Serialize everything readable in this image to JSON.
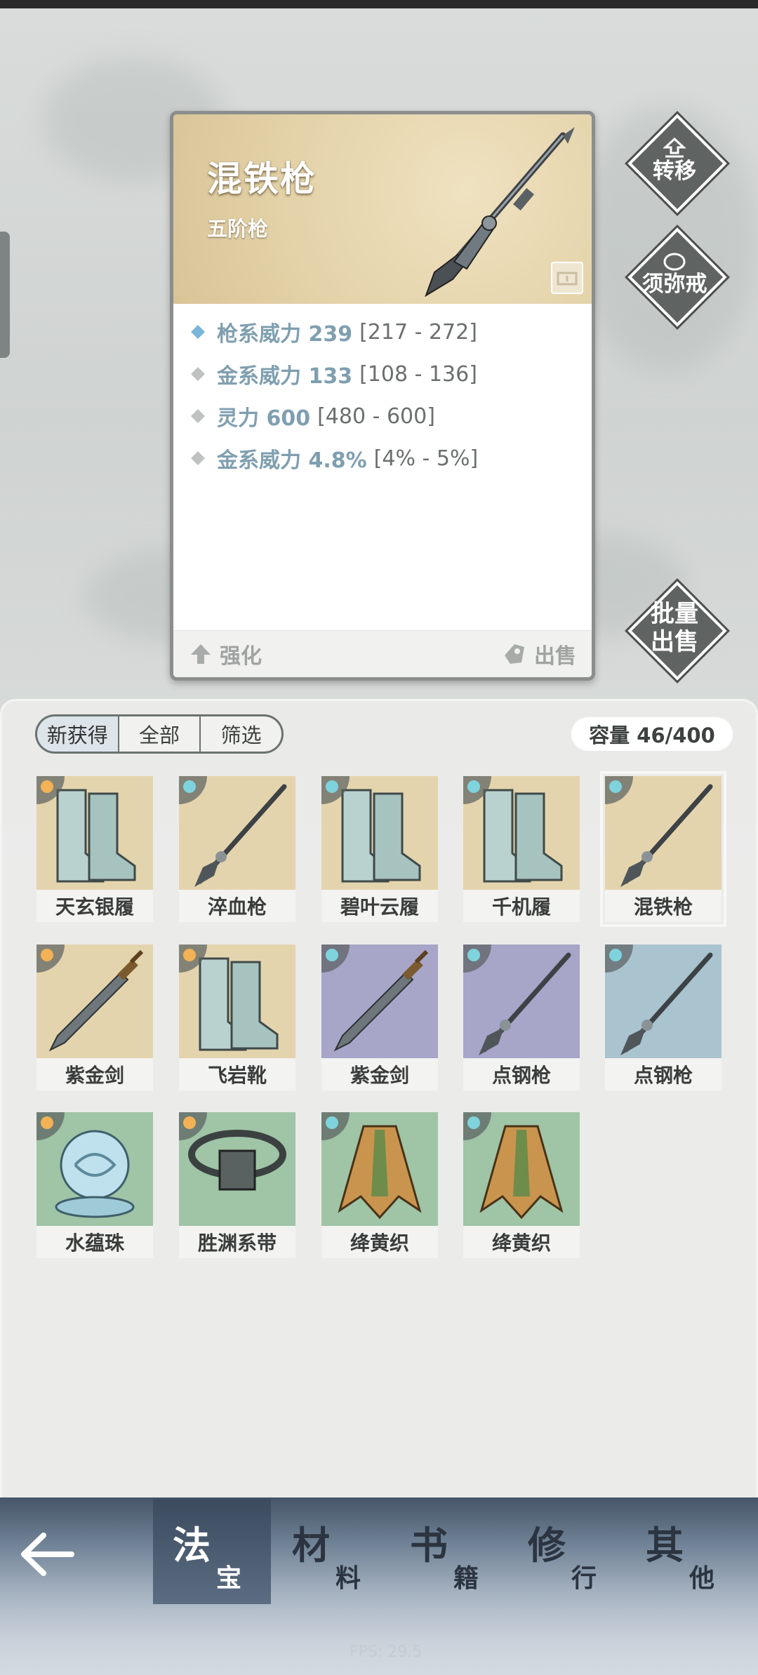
{
  "detail": {
    "name": "混铁枪",
    "grade": "五阶枪",
    "stats": [
      {
        "name": "枪系威力 239",
        "range": "[217 - 272]",
        "highlight": true
      },
      {
        "name": "金系威力 133",
        "range": "[108 - 136]",
        "highlight": false
      },
      {
        "name": "灵力 600",
        "range": "[480 - 600]",
        "highlight": false
      },
      {
        "name": "金系威力 4.8%",
        "range": "[4% - 5%]",
        "highlight": false
      }
    ],
    "enhance_label": "强化",
    "sell_label": "出售"
  },
  "side_buttons": {
    "transfer": "转移",
    "ring": "须弥戒",
    "batch_line1": "批量",
    "batch_line2": "出售"
  },
  "bag": {
    "filters": [
      "新获得",
      "全部",
      "筛选"
    ],
    "capacity": "容量 46/400",
    "items": [
      {
        "name": "天玄银履",
        "icon": "boots-icon",
        "bg": "#e4d4ad"
      },
      {
        "name": "淬血枪",
        "icon": "spear-icon",
        "bg": "#e4d4ad"
      },
      {
        "name": "碧叶云履",
        "icon": "boots-icon",
        "bg": "#e4d4ad"
      },
      {
        "name": "千机履",
        "icon": "boots-icon",
        "bg": "#e4d4ad"
      },
      {
        "name": "混铁枪",
        "icon": "spear-icon",
        "bg": "#e4d4ad",
        "selected": true
      },
      {
        "name": "紫金剑",
        "icon": "sword-icon",
        "bg": "#e4d4ad"
      },
      {
        "name": "飞岩靴",
        "icon": "boots-icon",
        "bg": "#e4d4ad"
      },
      {
        "name": "紫金剑",
        "icon": "sword-icon",
        "bg": "#a7a5c8"
      },
      {
        "name": "点钢枪",
        "icon": "spear-icon",
        "bg": "#a7a5c8"
      },
      {
        "name": "点钢枪",
        "icon": "spear-icon",
        "bg": "#a9c3cf"
      },
      {
        "name": "水蕴珠",
        "icon": "orb-icon",
        "bg": "#9fc4a6"
      },
      {
        "name": "胜渊系带",
        "icon": "belt-icon",
        "bg": "#9fc4a6"
      },
      {
        "name": "绛黄织",
        "icon": "robe-icon",
        "bg": "#9fc4a6"
      },
      {
        "name": "绛黄织",
        "icon": "robe-icon",
        "bg": "#9fc4a6"
      }
    ]
  },
  "nav": {
    "tabs": [
      {
        "big": "法",
        "small": "宝",
        "active": true
      },
      {
        "big": "材",
        "small": "料"
      },
      {
        "big": "书",
        "small": "籍"
      },
      {
        "big": "修",
        "small": "行"
      },
      {
        "big": "其",
        "small": "他"
      }
    ]
  },
  "fps": "FPS: 29.5"
}
